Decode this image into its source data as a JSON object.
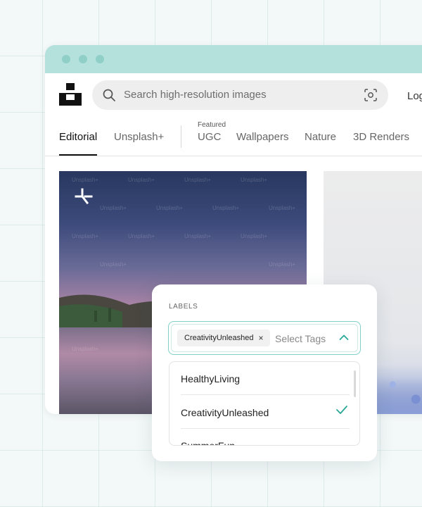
{
  "header": {
    "search_placeholder": "Search high-resolution images",
    "login_label": "Log"
  },
  "tabs": {
    "editorial": "Editorial",
    "unsplash_plus": "Unsplash+",
    "featured_badge": "Featured",
    "ugc": "UGC",
    "wallpapers": "Wallpapers",
    "nature": "Nature",
    "renders": "3D Renders",
    "active": "Editorial"
  },
  "photo": {
    "watermark": "Unsplash+"
  },
  "labels_panel": {
    "title": "LABELS",
    "selected_tag": "CreativityUnleashed",
    "select_placeholder": "Select Tags",
    "options": [
      "HealthyLiving",
      "CreativityUnleashed",
      "SummerFun"
    ],
    "checked_option": "CreativityUnleashed"
  },
  "colors": {
    "titlebar": "#b5e1dc",
    "accent": "#2aa897",
    "focus_border": "#7fd0c6"
  }
}
